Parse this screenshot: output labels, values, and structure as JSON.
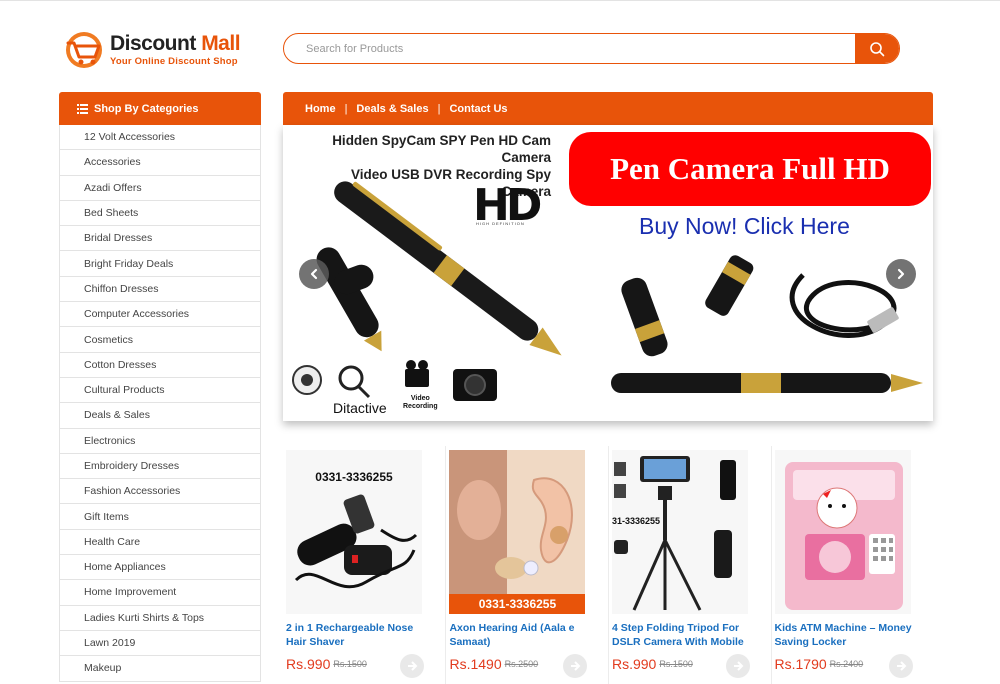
{
  "brand": {
    "name_part1": "Discount",
    "name_part2": "Mall",
    "tagline": "Your Online Discount Shop",
    "accent": "#e8540a"
  },
  "search": {
    "placeholder": "Search for Products",
    "button_icon": "search-icon"
  },
  "sidebar": {
    "heading": "Shop By Categories",
    "heading_icon": "list-icon",
    "items": [
      "12 Volt Accessories",
      "Accessories",
      "Azadi Offers",
      "Bed Sheets",
      "Bridal Dresses",
      "Bright Friday Deals",
      "Chiffon Dresses",
      "Computer Accessories",
      "Cosmetics",
      "Cotton Dresses",
      "Cultural Products",
      "Deals & Sales",
      "Electronics",
      "Embroidery Dresses",
      "Fashion Accessories",
      "Gift Items",
      "Health Care",
      "Home Appliances",
      "Home Improvement",
      "Ladies Kurti Shirts & Tops",
      "Lawn 2019",
      "Makeup"
    ]
  },
  "nav": {
    "home": "Home",
    "deals": "Deals & Sales",
    "contact": "Contact Us",
    "separator": "|"
  },
  "banner": {
    "title_line1": "Hidden SpyCam SPY Pen HD Cam Camera",
    "title_line2": "Video USB DVR Recording Spy Camera",
    "hd_text": "HD",
    "hd_sub": "HIGH DEFINITION",
    "headline": "Pen Camera Full HD",
    "cta": "Buy Now! Click Here",
    "ditactive": "Ditactive",
    "video_line1": "Video",
    "video_line2": "Recording",
    "prev_icon": "chevron-left-icon",
    "next_icon": "chevron-right-icon"
  },
  "products": [
    {
      "phone": "0331-3336255",
      "name": "2 in 1 Rechargeable Nose Hair Shaver",
      "price": "Rs.990",
      "old_price": "Rs.1500"
    },
    {
      "phone": "0331-3336255",
      "name": "Axon Hearing Aid (Aala e Samaat)",
      "price": "Rs.1490",
      "old_price": "Rs.2500"
    },
    {
      "phone": "31-3336255",
      "name": "4 Step Folding Tripod For DSLR Camera With Mobile",
      "price": "Rs.990",
      "old_price": "Rs.1500"
    },
    {
      "phone": "",
      "name": "Kids ATM Machine – Money Saving Locker",
      "price": "Rs.1790",
      "old_price": "Rs.2400"
    }
  ],
  "cart_icon": "arrow-right-icon"
}
